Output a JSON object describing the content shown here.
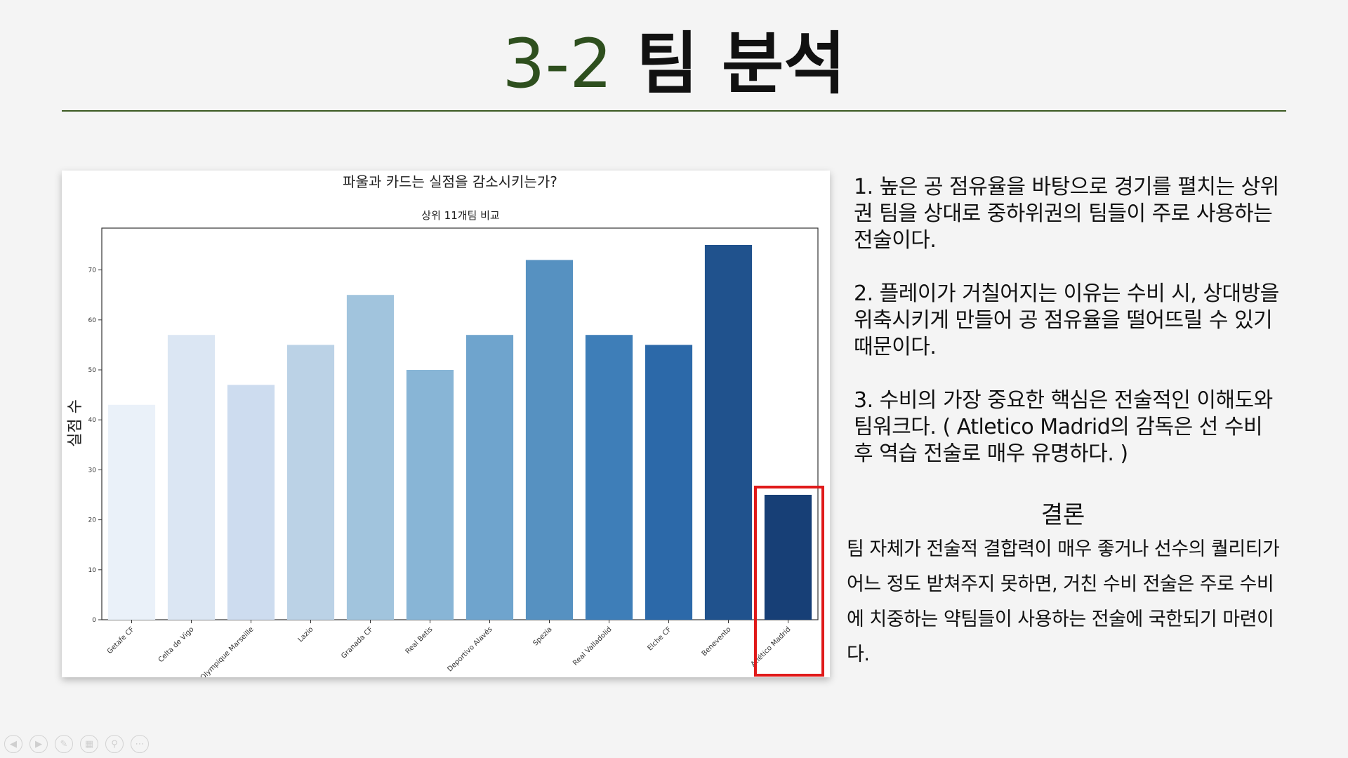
{
  "slide": {
    "title_number": "3-2",
    "title_text": "팀 분석"
  },
  "text_panel": {
    "paragraphs": [
      "1. 높은 공 점유율을 바탕으로 경기를 펼치는 상위권 팀을 상대로 중하위권의 팀들이 주로 사용하는 전술이다.",
      "2. 플레이가 거칠어지는 이유는 수비 시, 상대방을 위축시키게 만들어 공 점유율을 떨어뜨릴 수 있기 때문이다.",
      "3. 수비의 가장 중요한 핵심은 전술적인 이해도와 팀워크다. ( Atletico Madrid의 감독은 선 수비 후 역습 전술로 매우 유명하다. )"
    ],
    "conclusion_title": "결론",
    "conclusion_text": "팀 자체가 전술적 결합력이 매우 좋거나 선수의 퀄리티가 어느 정도 받쳐주지 못하면, 거친 수비 전술은 주로 수비에 치중하는 약팀들이 사용하는 전술에 국한되기 마련이다."
  },
  "nav": {
    "icons": [
      "prev-icon",
      "next-icon",
      "pen-icon",
      "slides-icon",
      "zoom-icon",
      "more-icon"
    ]
  },
  "chart_data": {
    "type": "bar",
    "title": "파울과 카드는 실점을 감소시키는가?",
    "subtitle": "상위 11개팀 비교",
    "xlabel": "",
    "ylabel": "실점 수",
    "categories": [
      "Getafe CF",
      "Celta de Vigo",
      "Olympique Marseille",
      "Lazio",
      "Granada CF",
      "Real Betis",
      "Deportivo Alavés",
      "Spezia",
      "Real Valladolid",
      "Elche CF",
      "Benevento",
      "Atlético Madrid"
    ],
    "values": [
      43,
      57,
      47,
      55,
      65,
      50,
      57,
      72,
      57,
      55,
      75,
      25
    ],
    "colors": [
      "#eaf1f9",
      "#dbe6f3",
      "#cddcef",
      "#bbd2e6",
      "#a1c4dd",
      "#88b5d6",
      "#6fa4cd",
      "#5691c1",
      "#3e7eb8",
      "#2c69a9",
      "#20528d",
      "#173f76"
    ],
    "ylim": [
      0,
      75
    ],
    "yticks": [
      0,
      10,
      20,
      30,
      40,
      50,
      60,
      70
    ],
    "highlight": "Atlético Madrid",
    "grid": false
  }
}
